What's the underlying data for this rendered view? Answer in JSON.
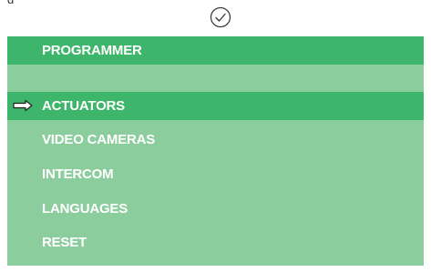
{
  "top_partial_text": "g",
  "confirm_icon": "check-circle-icon",
  "menu": {
    "header": "PROGRAMMER",
    "selected_indicator_icon": "right-arrow-icon",
    "items": [
      {
        "label": "ACTUATORS",
        "selected": true
      },
      {
        "label": "VIDEO CAMERAS",
        "selected": false
      },
      {
        "label": "INTERCOM",
        "selected": false
      },
      {
        "label": "LANGUAGES",
        "selected": false
      },
      {
        "label": "RESET",
        "selected": false
      }
    ]
  },
  "colors": {
    "header_bg": "#3db56a",
    "selected_bg": "#3db56a",
    "panel_bg": "#8ccd9e",
    "text": "#ffffff"
  }
}
